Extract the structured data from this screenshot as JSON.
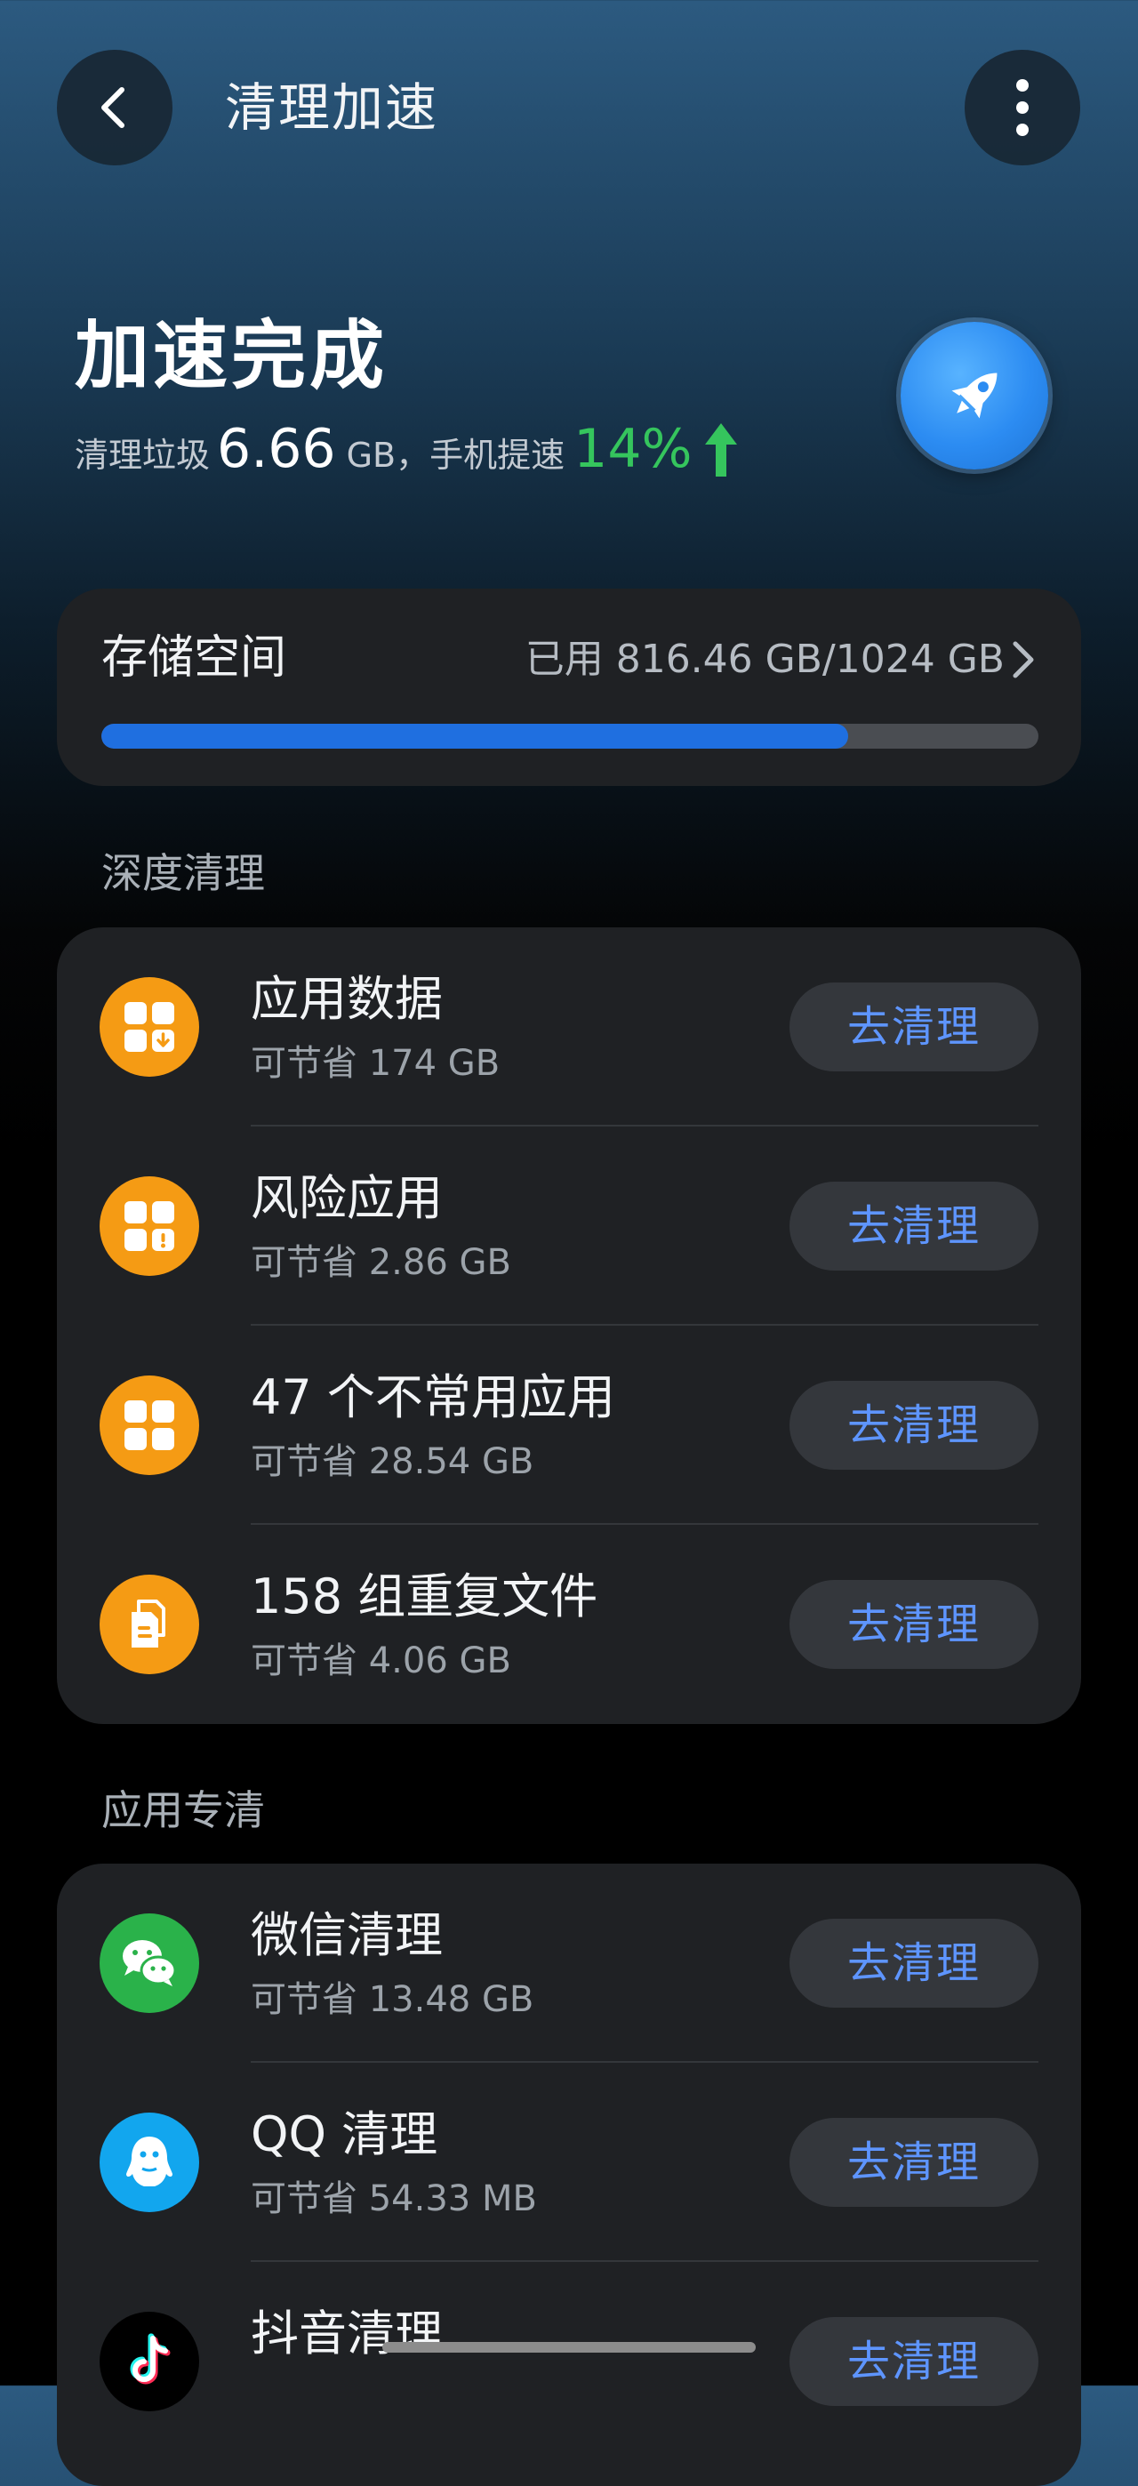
{
  "header": {
    "title": "清理加速",
    "back_icon": "chevron-left-icon",
    "more_icon": "more-vertical-icon"
  },
  "hero": {
    "title": "加速完成",
    "junk_prefix": "清理垃圾",
    "junk_amount": "6.66",
    "junk_unit": "GB，手机提速",
    "speedup_percent": "14%",
    "speedup_icon": "arrow-up-icon",
    "badge_icon": "rocket-icon"
  },
  "storage": {
    "label": "存储空间",
    "used_text": "已用 816.46 GB/1024 GB",
    "used_fraction": 0.7973,
    "chevron_icon": "chevron-right-icon"
  },
  "deep_clean": {
    "section_label": "深度清理",
    "items": [
      {
        "title": "应用数据",
        "subtitle": "可节省 174 GB",
        "button": "去清理",
        "icon": "app-data-icon",
        "icon_color": "#f59b14"
      },
      {
        "title": "风险应用",
        "subtitle": "可节省 2.86 GB",
        "button": "去清理",
        "icon": "risk-app-icon",
        "icon_color": "#f59b14"
      },
      {
        "title": "47 个不常用应用",
        "subtitle": "可节省 28.54 GB",
        "button": "去清理",
        "icon": "unused-apps-icon",
        "icon_color": "#f59b14"
      },
      {
        "title": "158 组重复文件",
        "subtitle": "可节省 4.06 GB",
        "button": "去清理",
        "icon": "duplicate-files-icon",
        "icon_color": "#f59b14"
      }
    ]
  },
  "app_clean": {
    "section_label": "应用专清",
    "items": [
      {
        "title": "微信清理",
        "subtitle": "可节省 13.48 GB",
        "button": "去清理",
        "icon": "wechat-icon",
        "icon_color": "#2ab24a"
      },
      {
        "title": "QQ 清理",
        "subtitle": "可节省 54.33 MB",
        "button": "去清理",
        "icon": "qq-icon",
        "icon_color": "#12a6ee"
      },
      {
        "title": "抖音清理",
        "subtitle": "",
        "button": "去清理",
        "icon": "tiktok-icon",
        "icon_color": "#000000"
      }
    ]
  },
  "colors": {
    "accent_blue": "#5e95ff",
    "progress_fill": "#1f6fe0",
    "success_green": "#35c55d",
    "warning_orange": "#f59b14",
    "card_bg": "#1f2124"
  }
}
